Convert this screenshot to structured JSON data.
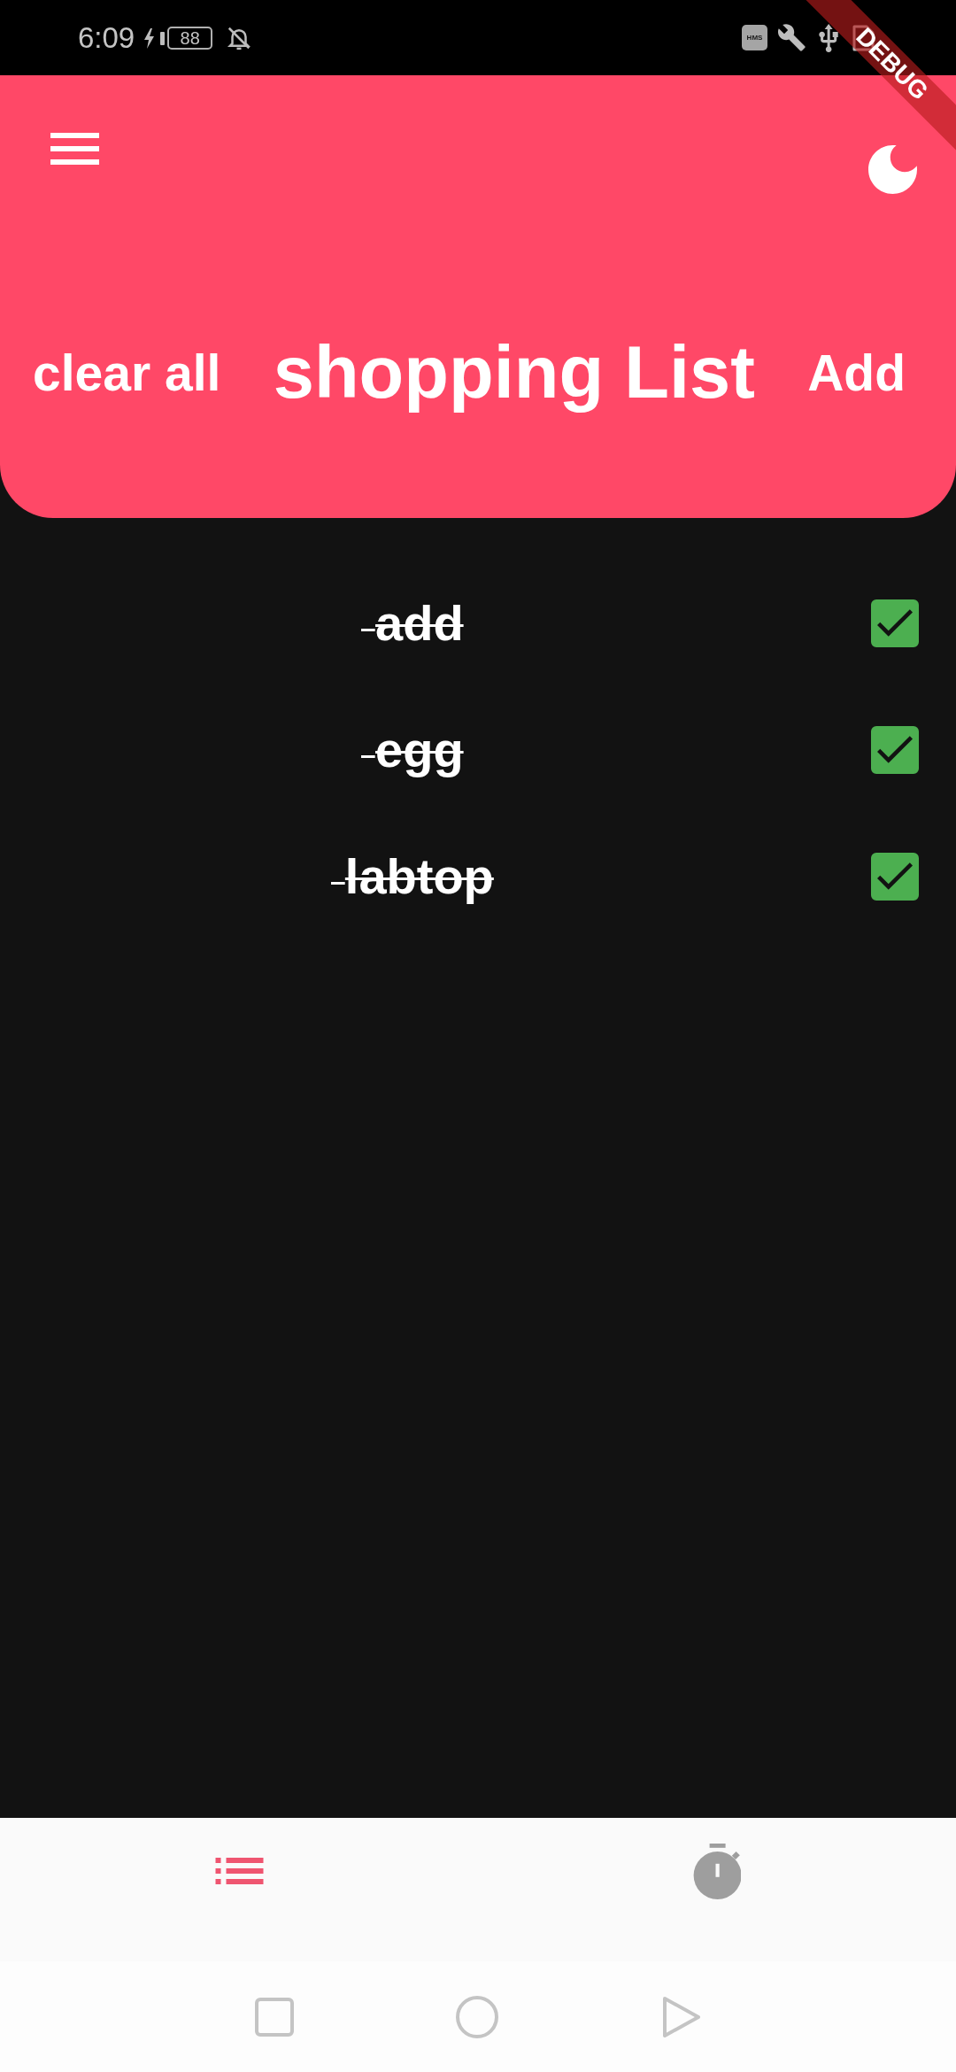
{
  "status_bar": {
    "time": "6:09",
    "battery": "88",
    "app_badge": "HMS"
  },
  "debug_banner": {
    "label": "DEBUG"
  },
  "header": {
    "clear_button": "clear all",
    "title": "shopping List",
    "add_button": "Add"
  },
  "items": [
    {
      "name": "add",
      "checked": true
    },
    {
      "name": "egg",
      "checked": true
    },
    {
      "name": "labtop",
      "checked": true
    }
  ],
  "bottom_nav": {
    "tabs": [
      {
        "selected": true
      },
      {
        "selected": false
      }
    ]
  }
}
